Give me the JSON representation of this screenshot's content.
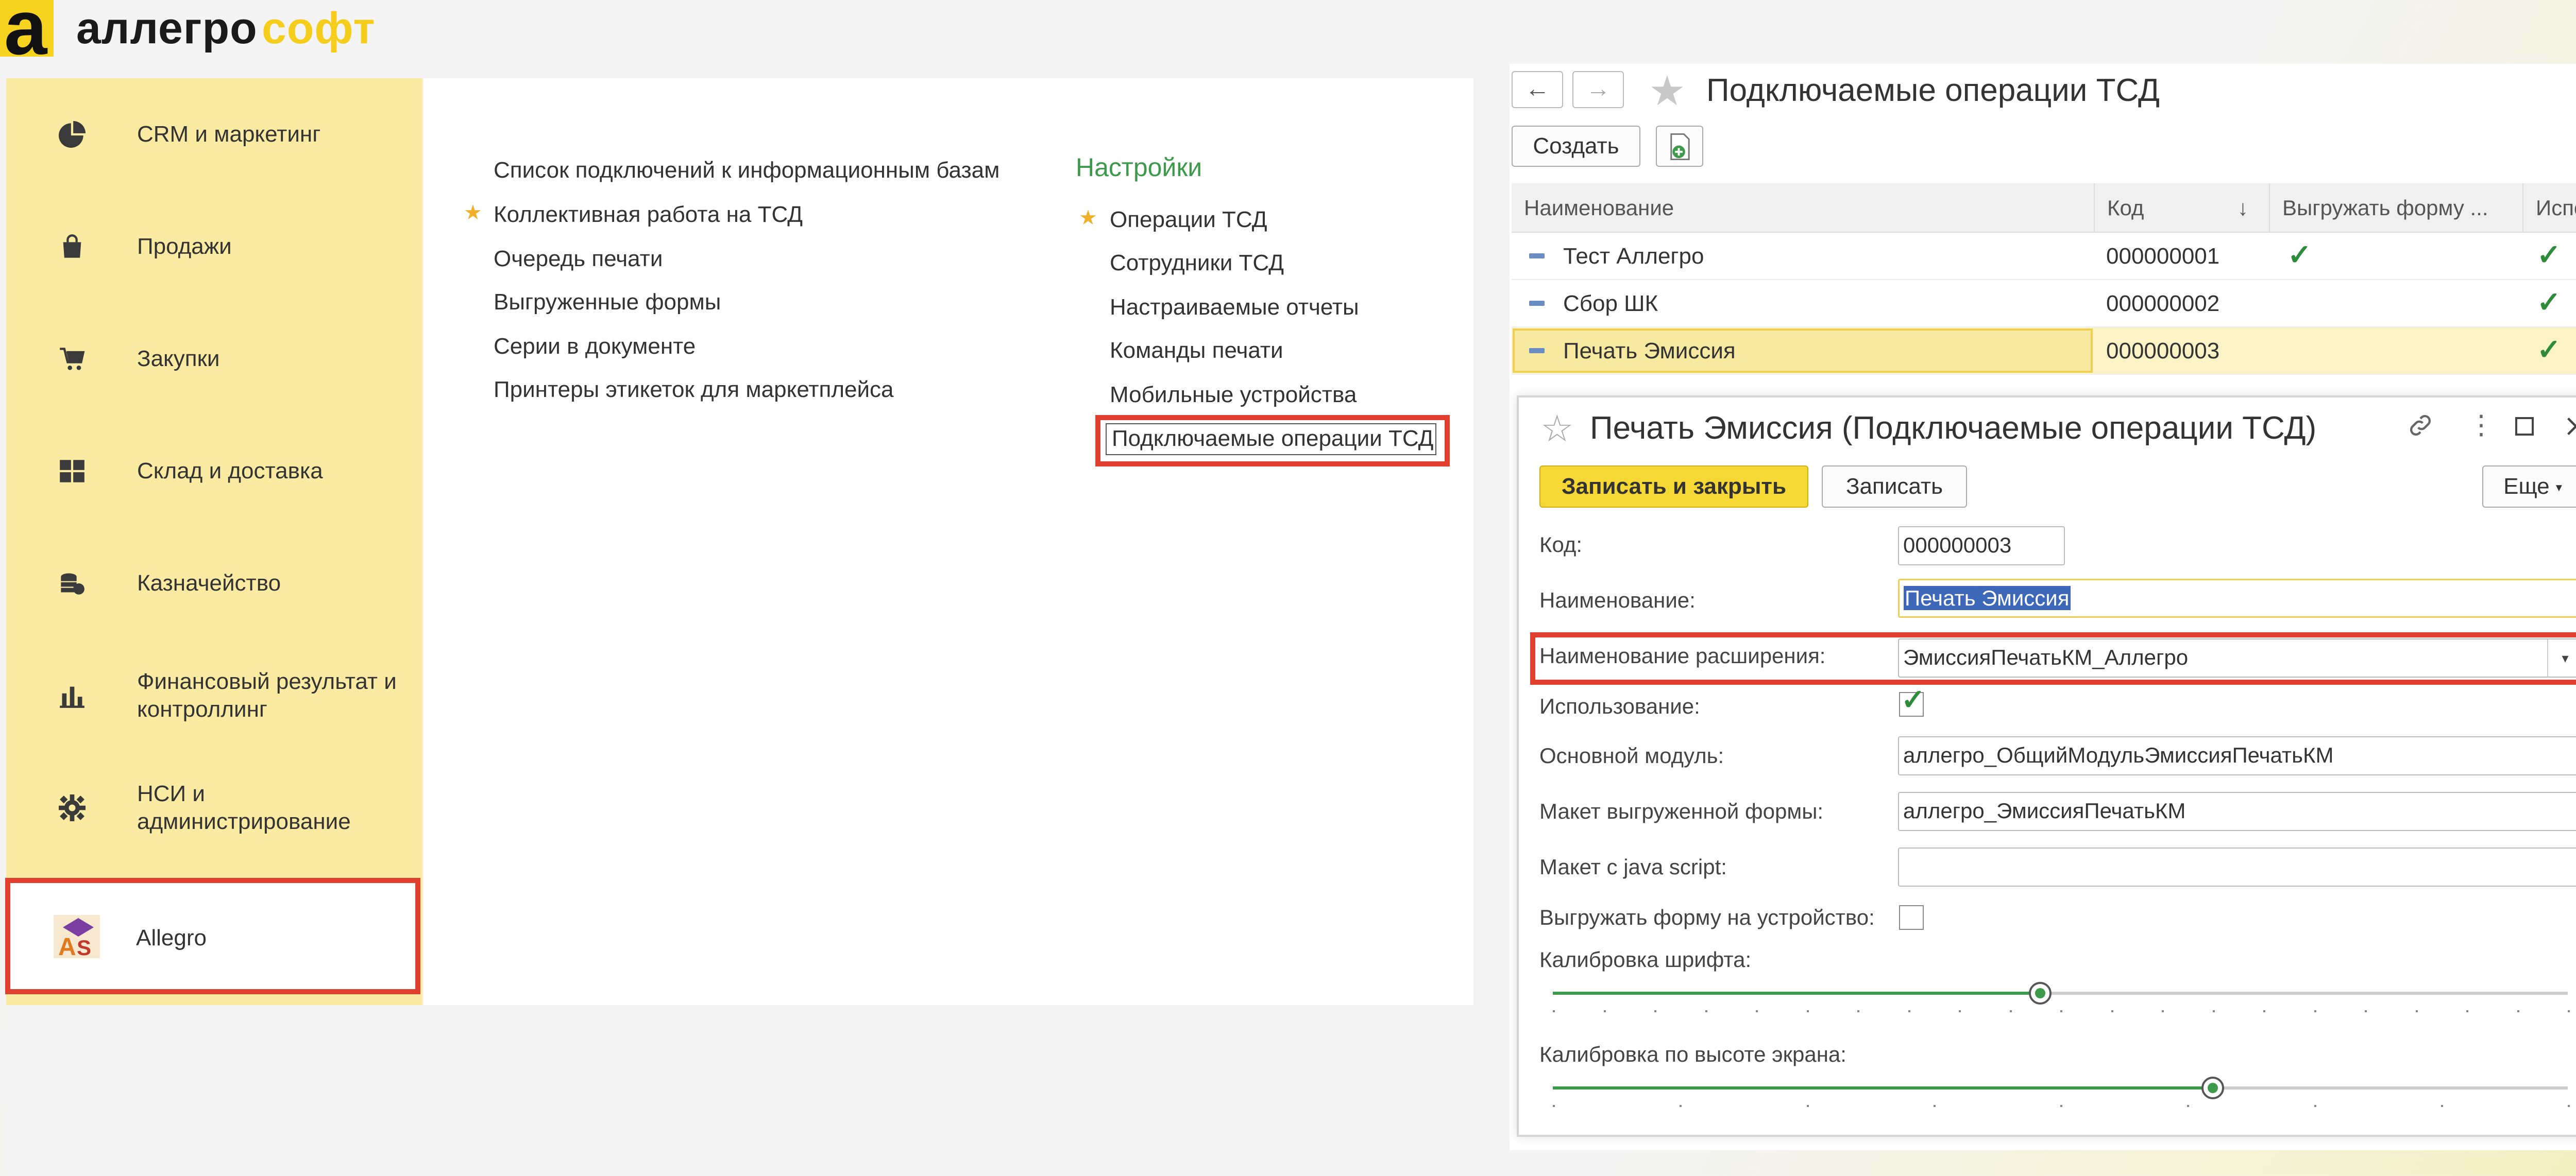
{
  "logo": {
    "part1": "аллегро",
    "part2": "софт",
    "mark": "а"
  },
  "sidebar": {
    "items": [
      {
        "label": "CRM и маркетинг",
        "icon": "pie-chart-icon"
      },
      {
        "label": "Продажи",
        "icon": "shopping-bag-icon"
      },
      {
        "label": "Закупки",
        "icon": "cart-icon"
      },
      {
        "label": "Склад и доставка",
        "icon": "grid-icon"
      },
      {
        "label": "Казначейство",
        "icon": "coins-icon"
      },
      {
        "label": "Финансовый результат и контроллинг",
        "icon": "bar-chart-icon"
      },
      {
        "label": "НСИ и администрирование",
        "icon": "gear-icon"
      },
      {
        "label": "Allegro",
        "icon": "allegro-logo-icon"
      }
    ]
  },
  "middle": {
    "links_left": [
      "Список подключений к информационным базам",
      "Коллективная работа на ТСД",
      "Очередь печати",
      "Выгруженные формы",
      "Серии в документе",
      "Принтеры этикеток для маркетплейса"
    ],
    "settings_title": "Настройки",
    "links_right": [
      "Операции ТСД",
      "Сотрудники ТСД",
      "Настраиваемые отчеты",
      "Команды печати",
      "Мобильные устройства",
      "Подключаемые операции ТСД"
    ]
  },
  "list": {
    "title": "Подключаемые операции ТСД",
    "create_label": "Создать",
    "columns": [
      "Наименование",
      "Код",
      "Выгружать форму ...",
      "Исполь"
    ],
    "sort_icon": "↓",
    "rows": [
      {
        "name": "Тест Аллегро",
        "code": "000000001",
        "upload": true,
        "use": true
      },
      {
        "name": "Сбор ШК",
        "code": "000000002",
        "upload": false,
        "use": true
      },
      {
        "name": "Печать Эмиссия",
        "code": "000000003",
        "upload": false,
        "use": true
      }
    ]
  },
  "dialog": {
    "title": "Печать Эмиссия (Подключаемые операции ТСД)",
    "save_close_label": "Записать и закрыть",
    "save_label": "Записать",
    "more_label": "Еще",
    "fields": {
      "code_label": "Код:",
      "code_value": "000000003",
      "name_label": "Наименование:",
      "name_value": "Печать Эмиссия",
      "ext_label": "Наименование расширения:",
      "ext_value": "ЭмиссияПечатьКМ_Аллегро",
      "use_label": "Использование:",
      "module_label": "Основной модуль:",
      "module_value": "аллегро_ОбщийМодульЭмиссияПечатьКМ",
      "layout_label": "Макет выгруженной формы:",
      "layout_value": "аллегро_ЭмиссияПечатьКМ",
      "js_label": "Макет с java script:",
      "js_value": "",
      "upload_label": "Выгружать форму на устройство:",
      "font_cal_label": "Калибровка шрифта:",
      "screen_cal_label": "Калибровка по высоте экрана:"
    },
    "font_cal_fraction": 0.48,
    "screen_cal_fraction": 0.65
  },
  "colors": {
    "accent_yellow": "#f6d834",
    "highlight_red": "#e2402f",
    "green": "#3d9a4b"
  }
}
